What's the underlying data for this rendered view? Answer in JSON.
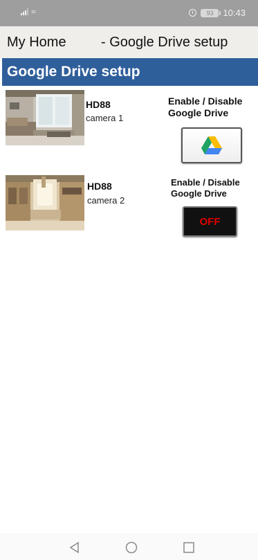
{
  "status_bar": {
    "battery": "93",
    "time": "10:43",
    "icons": [
      "signal-icon",
      "wifi-icon",
      "alarm-icon",
      "battery-icon"
    ]
  },
  "header": {
    "home_label": "My Home",
    "title": "- Google Drive setup"
  },
  "section": {
    "title": "Google Drive setup",
    "color": "#2f5f9b"
  },
  "cameras": [
    {
      "model": "HD88",
      "name": "camera 1",
      "toggle_label_line1": "Enable / Disable",
      "toggle_label_line2": "Google Drive",
      "state": "enabled",
      "button_icon": "google-drive-icon"
    },
    {
      "model": "HD88",
      "name": "camera 2",
      "toggle_label_line1": "Enable / Disable",
      "toggle_label_line2": "Google Drive",
      "state": "disabled",
      "button_text": "OFF",
      "button_text_color": "#e00000"
    }
  ],
  "nav_bar": {
    "icons": [
      "back-icon",
      "home-icon",
      "recent-apps-icon"
    ]
  }
}
